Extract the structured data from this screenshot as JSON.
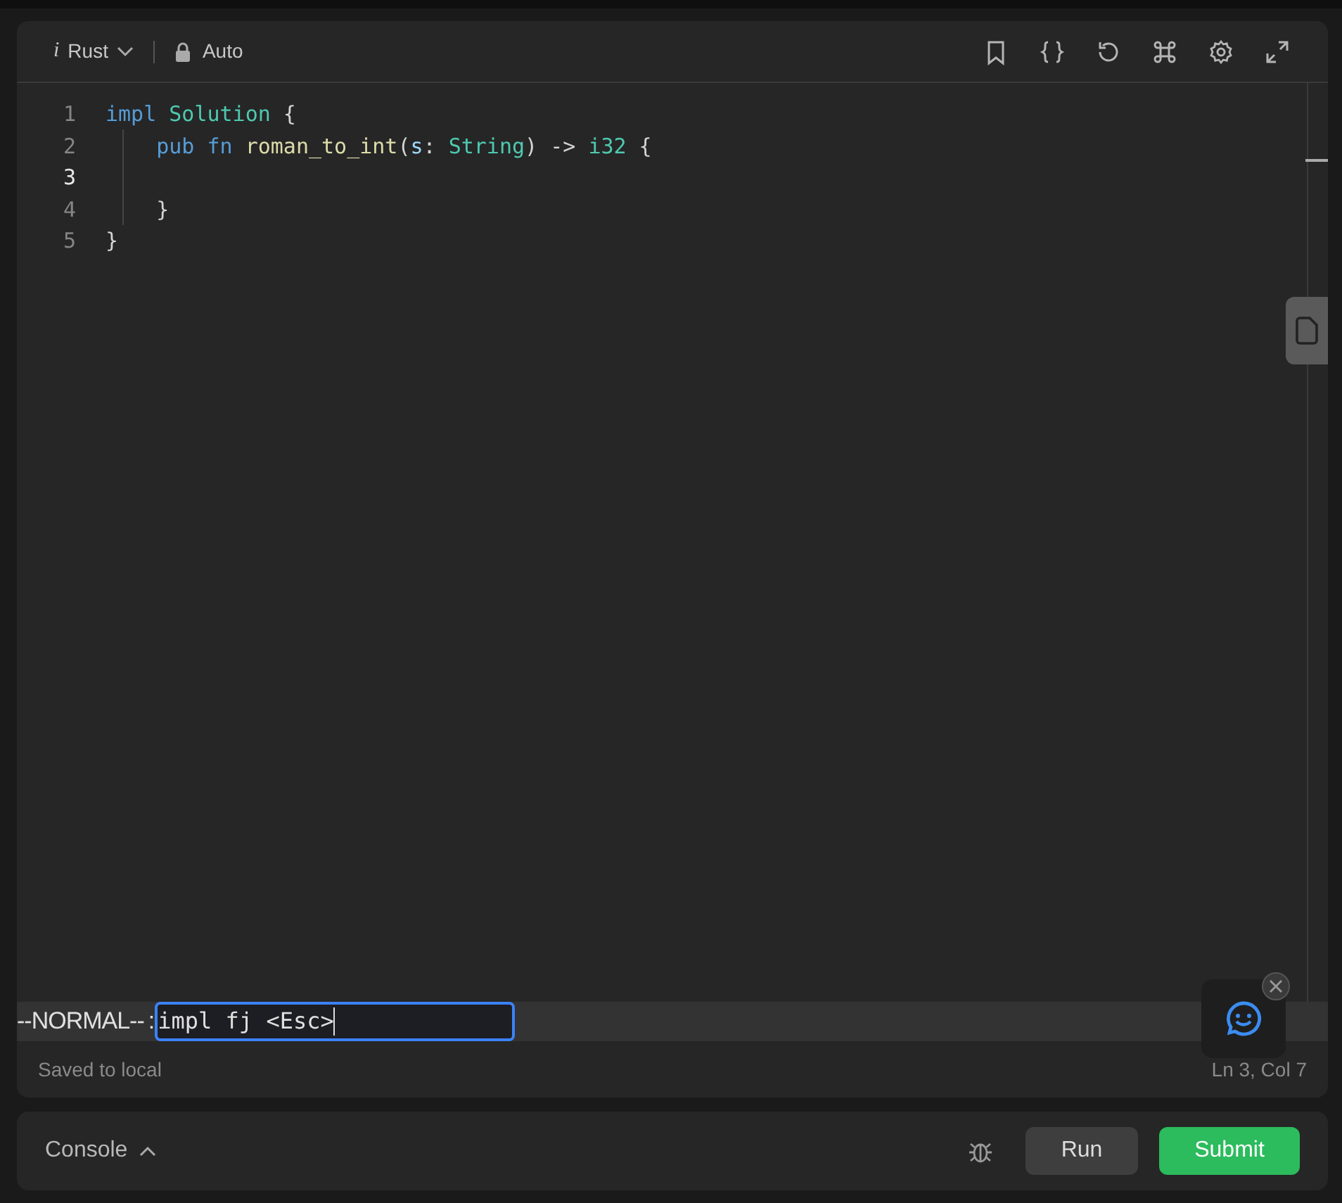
{
  "toolbar": {
    "info_glyph": "i",
    "language": "Rust",
    "mode": "Auto"
  },
  "code_lines": [
    {
      "number": "1",
      "current": false,
      "tokens": [
        {
          "text": "impl",
          "kind": "keyword"
        },
        {
          "text": " Solution",
          "kind": "type"
        },
        {
          "text": " {",
          "kind": "plain"
        }
      ]
    },
    {
      "number": "2",
      "current": false,
      "tokens": [
        {
          "text": "    pub",
          "kind": "keyword"
        },
        {
          "text": " fn",
          "kind": "keyword"
        },
        {
          "text": " roman_to_int",
          "kind": "function"
        },
        {
          "text": "(",
          "kind": "plain"
        },
        {
          "text": "s",
          "kind": "param"
        },
        {
          "text": ": ",
          "kind": "plain"
        },
        {
          "text": "String",
          "kind": "type"
        },
        {
          "text": ") -> ",
          "kind": "plain"
        },
        {
          "text": "i32",
          "kind": "type"
        },
        {
          "text": " {",
          "kind": "plain"
        }
      ]
    },
    {
      "number": "3",
      "current": true
    },
    {
      "number": "4",
      "current": false,
      "tokens": [
        {
          "text": "    }",
          "kind": "plain"
        }
      ]
    },
    {
      "number": "5",
      "current": false,
      "tokens": [
        {
          "text": "}",
          "kind": "plain"
        }
      ]
    }
  ],
  "vim": {
    "mode": "--NORMAL--",
    "prompt": ":",
    "command": "impl fj <Esc>"
  },
  "status": {
    "saved": "Saved to local",
    "position": "Ln 3, Col 7"
  },
  "console": {
    "label": "Console",
    "run": "Run",
    "submit": "Submit"
  }
}
